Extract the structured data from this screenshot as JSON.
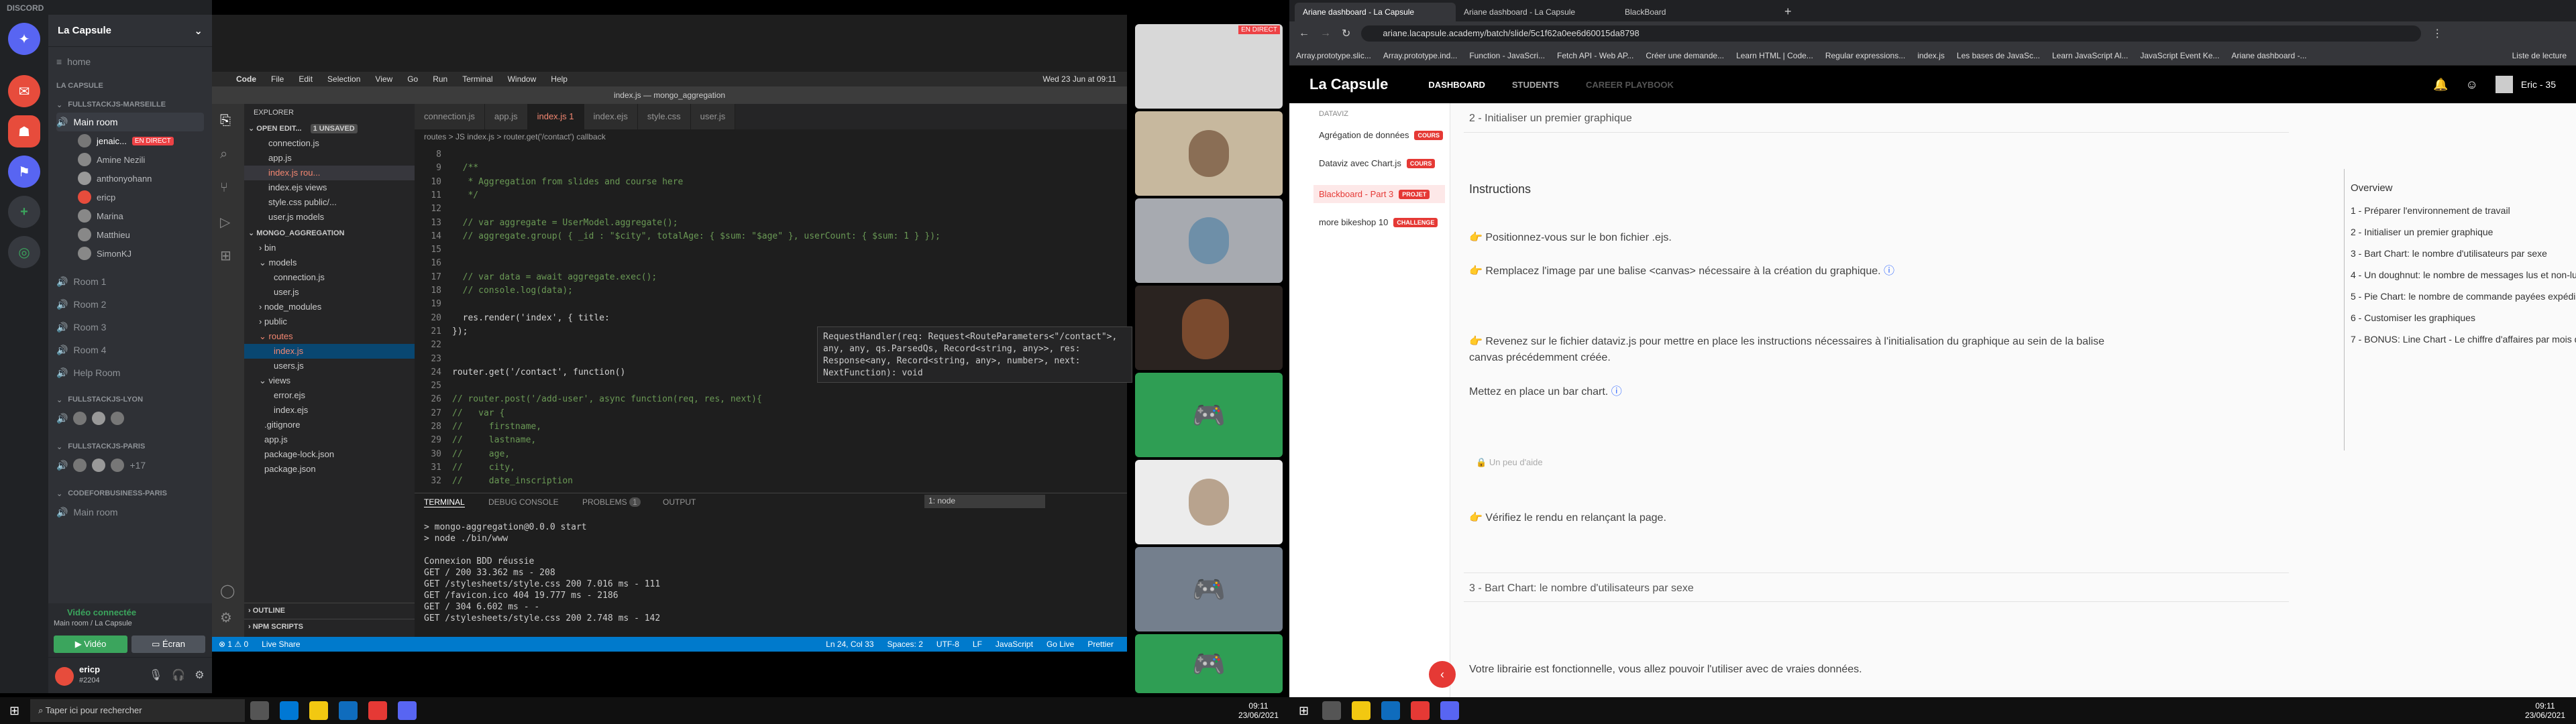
{
  "discord": {
    "app_title": "DISCORD",
    "server_name": "La Capsule",
    "home": "home",
    "channels_top": "LA CAPSULE",
    "category1": "FULLSTACKJS-MARSEILLE",
    "main_room": "Main room",
    "users": [
      "jenaic...",
      "Amine Nezili",
      "anthonyohann",
      "ericp",
      "Marina",
      "Matthieu",
      "SimonKJ"
    ],
    "live_badge": "EN DIRECT",
    "rooms": [
      "Room 1",
      "Room 2",
      "Room 3",
      "Room 4",
      "Help Room"
    ],
    "category2": "FULLSTACKJS-LYON",
    "lobby_count": "+17",
    "category3": "FULLSTACKJS-PARIS",
    "category4": "CODEFORBUSINESS-PARIS",
    "main_room2": "Main room",
    "voice_status": "Vidéo connectée",
    "voice_channel": "Main room / La Capsule",
    "video_btn": "Vidéo",
    "screen_btn": "Écran",
    "username": "ericp",
    "user_tag": "#2204",
    "stream_badge": "EN DIRECT",
    "colors": {
      "green": "#3ba55d",
      "blurple": "#5865f2",
      "live": "#ed4245"
    }
  },
  "mac": {
    "menu": [
      "Code",
      "File",
      "Edit",
      "Selection",
      "View",
      "Go",
      "Run",
      "Terminal",
      "Window",
      "Help"
    ],
    "clock": "Wed 23 Jun at 09:11"
  },
  "vscode": {
    "title": "index.js — mongo_aggregation",
    "explorer": "EXPLORER",
    "open_editors": "OPEN EDIT...",
    "unsaved": "1 UNSAVED",
    "open_files": [
      "connection.js",
      "app.js",
      "index.js rou...",
      "index.ejs views",
      "style.css public/...",
      "user.js models"
    ],
    "project": "MONGO_AGGREGATION",
    "tree": [
      "bin",
      "models",
      "connection.js",
      "user.js",
      "node_modules",
      "public",
      "routes",
      "index.js",
      "users.js",
      "views",
      "error.ejs",
      "index.ejs",
      ".gitignore",
      "app.js",
      "package-lock.json",
      "package.json"
    ],
    "outline": "OUTLINE",
    "npm": "NPM SCRIPTS",
    "tabs": [
      "connection.js",
      "app.js",
      "index.js 1",
      "index.ejs",
      "style.css",
      "user.js"
    ],
    "breadcrumb": "routes > JS index.js > router.get('/contact') callback",
    "code": [
      {
        "n": "8",
        "t": ""
      },
      {
        "n": "9",
        "t": "  /**"
      },
      {
        "n": "10",
        "t": "   * Aggregation from slides and course here"
      },
      {
        "n": "11",
        "t": "   */"
      },
      {
        "n": "12",
        "t": ""
      },
      {
        "n": "13",
        "t": "  // var aggregate = UserModel.aggregate();"
      },
      {
        "n": "14",
        "t": "  // aggregate.group( { _id : \"$city\", totalAge: { $sum: \"$age\" }, userCount: { $sum: 1 } });"
      },
      {
        "n": "15",
        "t": ""
      },
      {
        "n": "16",
        "t": ""
      },
      {
        "n": "17",
        "t": "  // var data = await aggregate.exec();"
      },
      {
        "n": "18",
        "t": "  // console.log(data);"
      },
      {
        "n": "19",
        "t": ""
      },
      {
        "n": "20",
        "t": "  res.render('index', { title:"
      },
      {
        "n": "21",
        "t": "});"
      },
      {
        "n": "22",
        "t": ""
      },
      {
        "n": "23",
        "t": ""
      },
      {
        "n": "24",
        "t": "router.get('/contact', function()"
      },
      {
        "n": "25",
        "t": ""
      },
      {
        "n": "26",
        "t": "// router.post('/add-user', async function(req, res, next){"
      },
      {
        "n": "27",
        "t": "//   var {"
      },
      {
        "n": "28",
        "t": "//     firstname,"
      },
      {
        "n": "29",
        "t": "//     lastname,"
      },
      {
        "n": "30",
        "t": "//     age,"
      },
      {
        "n": "31",
        "t": "//     city,"
      },
      {
        "n": "32",
        "t": "//     date_inscription"
      }
    ],
    "tooltip": "RequestHandler(req: Request<RouteParameters<\"/contact\">,\nany, any, qs.ParsedQs, Record<string, any>>, res:\nResponse<any, Record<string, any>, number>, next:\nNextFunction): void",
    "panel_tabs": [
      "TERMINAL",
      "DEBUG CONSOLE",
      "PROBLEMS",
      "OUTPUT"
    ],
    "problems_count": "1",
    "terminal_select": "1: node",
    "terminal": "> mongo-aggregation@0.0.0 start\n> node ./bin/www\n\nConnexion BDD réussie\nGET / 200 33.362 ms - 208\nGET /stylesheets/style.css 200 7.016 ms - 111\nGET /favicon.ico 404 19.777 ms - 2186\nGET / 304 6.602 ms - -\nGET /stylesheets/style.css 200 2.748 ms - 142",
    "status": {
      "errors": "⊗ 1 ⚠ 0",
      "live": "Live Share",
      "position": "Ln 24, Col 33",
      "spaces": "Spaces: 2",
      "enc": "UTF-8",
      "eol": "LF",
      "lang": "JavaScript",
      "golive": "Go Live",
      "prettier": "Prettier"
    }
  },
  "chrome": {
    "tabs": [
      "Ariane dashboard - La Capsule",
      "Ariane dashboard - La Capsule",
      "BlackBoard"
    ],
    "url": "ariane.lacapsule.academy/batch/slide/5c1f62a0ee6d60015da8798",
    "bookmarks": [
      "Array.prototype.slic...",
      "Array.prototype.ind...",
      "Function - JavaScri...",
      "Fetch API - Web AP...",
      "Créer une demande...",
      "Learn HTML | Code...",
      "Regular expressions...",
      "index.js",
      "Les bases de JavaSc...",
      "Learn JavaScript Al...",
      "JavaScript Event Ke...",
      "Ariane dashboard -..."
    ],
    "reading_list": "Liste de lecture"
  },
  "lacapsule": {
    "logo": "La Capsule",
    "nav": [
      "DASHBOARD",
      "STUDENTS",
      "CAREER PLAYBOOK"
    ],
    "user": "Eric - 35",
    "section": "DATAVIZ",
    "side": [
      {
        "label": "Agrégation de données",
        "tag": "COURS"
      },
      {
        "label": "Dataviz avec Chart.js",
        "tag": "COURS"
      },
      {
        "label": "Blackboard - Part 3",
        "tag": "PROJET"
      },
      {
        "label": "more bikeshop 10",
        "tag": "CHALLENGE"
      }
    ],
    "step_title": "2 - Initialiser un premier graphique",
    "instructions_h": "Instructions",
    "instructions": [
      "Positionnez-vous sur le bon fichier .ejs.",
      "Remplacez l'image par une balise <canvas> nécessaire à la création du graphique.",
      "Revenez sur le fichier dataviz.js pour mettre en place les instructions nécessaires à l'initialisation du graphique au sein de la balise canvas précédemment créée.",
      "Mettez en place un bar chart.",
      "Un peu d'aide",
      "Vérifiez le rendu en relançant la page."
    ],
    "overview_h": "Overview",
    "overview": [
      "1 - Préparer l'environnement de travail",
      "2 - Initialiser un premier graphique",
      "3 - Bart Chart: le nombre d'utilisateurs par sexe",
      "4 - Un doughnut: le nombre de messages lus et non-lus",
      "5 - Pie Chart: le nombre de commande payées expédiées et payées non-expédiées",
      "6 - Customiser les graphiques",
      "7 - BONUS: Line Chart - Le chiffre d'affaires par mois d'une année"
    ],
    "step3_title": "3 - Bart Chart: le nombre d'utilisateurs par sexe",
    "step3_text": "Votre librairie est fonctionnelle, vous allez pouvoir l'utiliser avec de vraies données.",
    "colors": {
      "accent": "#e53935",
      "bg": "#000000"
    }
  },
  "taskbar": {
    "search": "Taper ici pour rechercher",
    "time": "09:11",
    "date": "23/06/2021",
    "time2": "09:11",
    "date2": "23/06/2021"
  }
}
